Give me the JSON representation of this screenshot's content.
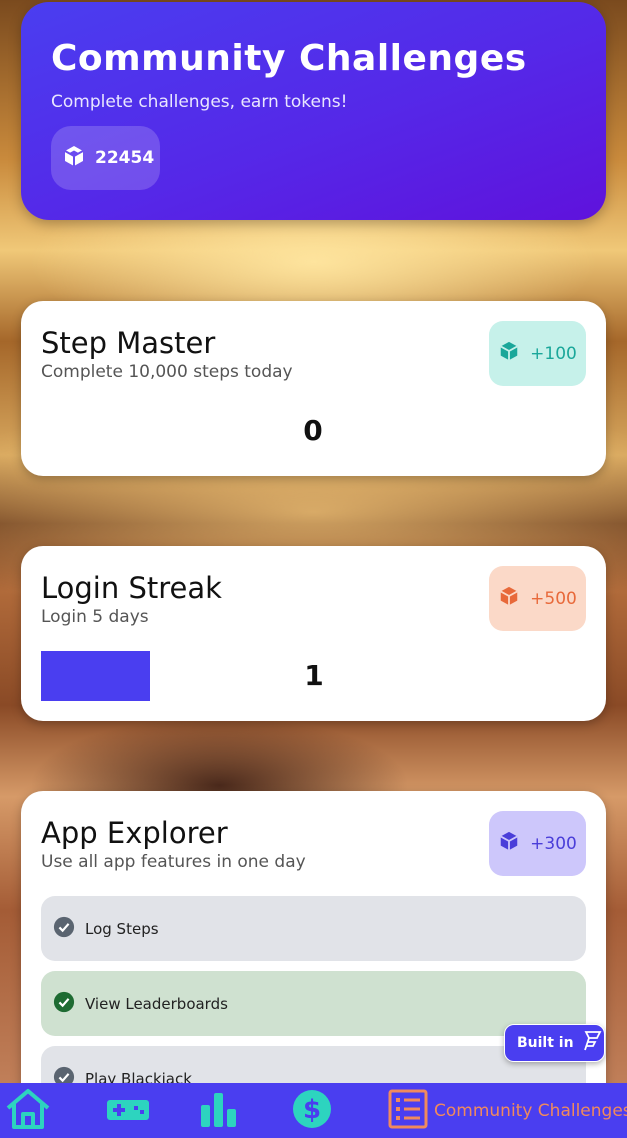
{
  "header": {
    "title": "Community Challenges",
    "subtitle": "Complete challenges, earn tokens!",
    "token_count": "22454"
  },
  "challenges": [
    {
      "title": "Step Master",
      "description": "Complete 10,000 steps today",
      "reward": "+100",
      "progress_value": "0",
      "accent": "#1aa79a"
    },
    {
      "title": "Login Streak",
      "description": "Login 5 days",
      "reward": "+500",
      "progress_value": "1",
      "accent": "#e8693a"
    },
    {
      "title": "App Explorer",
      "description": "Use all app features in one day",
      "reward": "+300",
      "accent": "#4a3ed9",
      "tasks": [
        {
          "label": "Log Steps",
          "done": false
        },
        {
          "label": "View Leaderboards",
          "done": true
        },
        {
          "label": "Play Blackjack",
          "done": false
        }
      ]
    }
  ],
  "built_in": {
    "label": "Built in"
  },
  "bottom_nav": {
    "items": [
      {
        "icon": "home-icon"
      },
      {
        "icon": "gamepad-icon"
      },
      {
        "icon": "bar-chart-icon"
      },
      {
        "icon": "dollar-icon"
      },
      {
        "icon": "list-icon",
        "label": "Community Challenges",
        "active": true
      }
    ]
  },
  "colors": {
    "primary": "#4a3ef0",
    "nav_active": "#f08a5d",
    "nav_icon": "#2dd4bf"
  }
}
